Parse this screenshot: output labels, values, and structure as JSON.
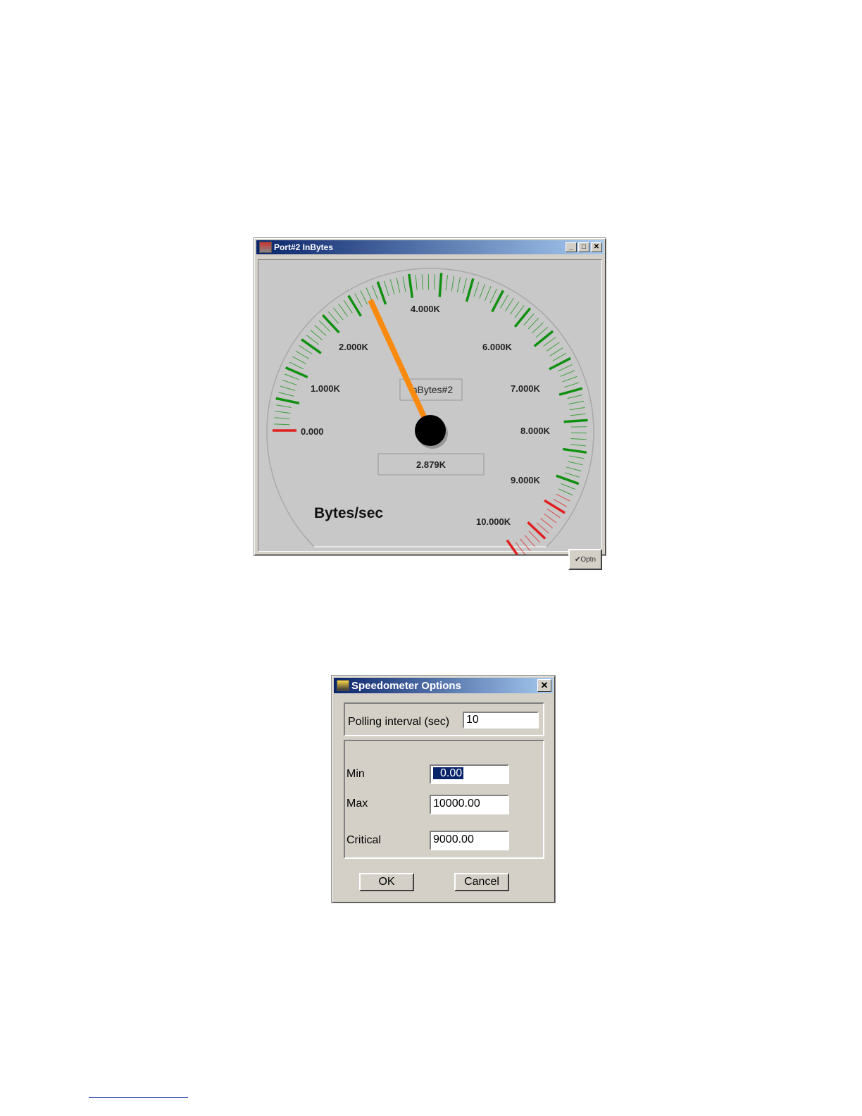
{
  "gauge_window": {
    "title": "Port#2 InBytes",
    "controls": {
      "minimize": "_",
      "maximize": "□",
      "close": "✕"
    },
    "gauge": {
      "value": 2879,
      "value_label": "2.879K",
      "min": 0,
      "max": 10000,
      "critical": 9000,
      "name_label": "InBytes#2",
      "units": "Bytes/sec",
      "tick_labels": [
        "0.000",
        "1.000K",
        "2.000K",
        "4.000K",
        "6.000K",
        "7.000K",
        "8.000K",
        "9.000K",
        "10.000K"
      ],
      "colors": {
        "normal": "#109010",
        "critical": "#e02020",
        "needle": "#f88a10",
        "hub": "#000000"
      }
    },
    "options_button": "Optn"
  },
  "options_dialog": {
    "title": "Speedometer Options",
    "close": "✕",
    "polling_label": "Polling interval (sec)",
    "polling_value": "10",
    "min_label": "Min",
    "min_value": "0.00",
    "max_label": "Max",
    "max_value": "10000.00",
    "critical_label": "Critical",
    "critical_value": "9000.00",
    "ok": "OK",
    "cancel": "Cancel"
  }
}
